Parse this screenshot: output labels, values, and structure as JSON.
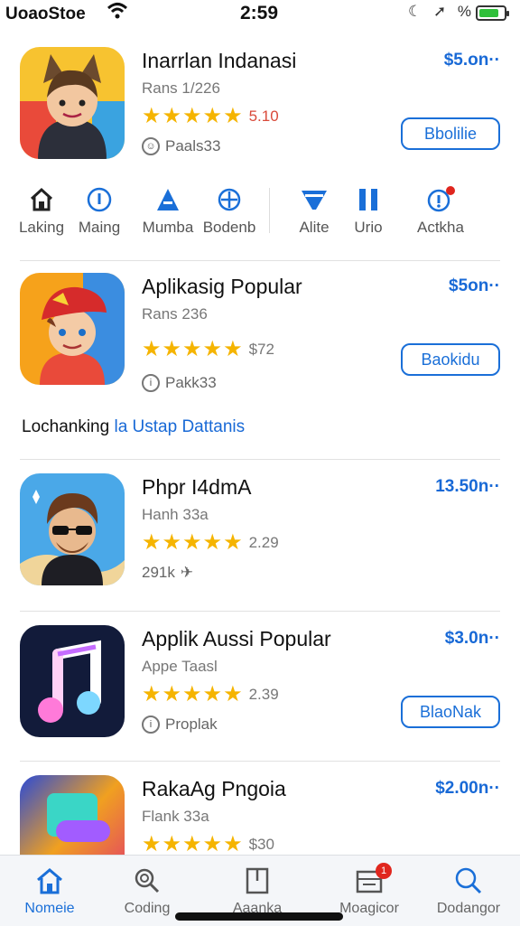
{
  "status_bar": {
    "carrier": "UoaoStoe",
    "time": "2:59",
    "icons": "☾ ➚ %",
    "battery_level": 0.8
  },
  "apps": [
    {
      "name": "Inarrlan Indanasi",
      "subtitle": "Rans 1/226",
      "rating": "5.10",
      "meta": "Paals33",
      "price": "$5.on··",
      "button": "Bbolilie"
    },
    {
      "name": "Aplikasig Popular",
      "subtitle": "Rans 236",
      "rating": "$72",
      "meta": "Pakk33",
      "price": "$5on··",
      "button": "Baokidu"
    },
    {
      "name": "Phpr I4dmA",
      "subtitle": "Hanh 33a",
      "rating": "2.29",
      "meta": "291k",
      "price": "13.50n··",
      "button": ""
    },
    {
      "name": "Applik Aussi Popular",
      "subtitle": "Appe Taasl",
      "rating": "2.39",
      "meta": "Proplak",
      "price": "$3.0n··",
      "button": "BlaoNak"
    },
    {
      "name": "RakaAg Pngoia",
      "subtitle": "Flank 33a",
      "rating": "$30",
      "meta": "",
      "price": "$2.00n··",
      "button": ""
    }
  ],
  "categories": [
    {
      "label": "Laking",
      "icon": "home-icon"
    },
    {
      "label": "Maing",
      "icon": "info-icon"
    },
    {
      "label": "Mumba",
      "icon": "triangle-icon"
    },
    {
      "label": "Bodenb",
      "icon": "crosshair-icon"
    },
    {
      "label": "Alite",
      "icon": "funnel-icon"
    },
    {
      "label": "Urio",
      "icon": "pause-icon"
    },
    {
      "label": "Actkha",
      "icon": "alert-icon"
    }
  ],
  "section_link": {
    "prefix": "Lochanking ",
    "highlight": "la Ustap Dattanis"
  },
  "tabs": [
    {
      "label": "Nomeie",
      "icon": "home-icon",
      "active": true
    },
    {
      "label": "Coding",
      "icon": "search-icon",
      "active": false
    },
    {
      "label": "Aaanka",
      "icon": "book-icon",
      "active": false
    },
    {
      "label": "Moagicor",
      "icon": "inbox-icon",
      "active": false,
      "badge": "1"
    },
    {
      "label": "Dodangor",
      "icon": "search-icon",
      "active": false
    }
  ],
  "colors": {
    "accent": "#1a6fd8",
    "star": "#f5b400",
    "badge": "#e0261e"
  }
}
